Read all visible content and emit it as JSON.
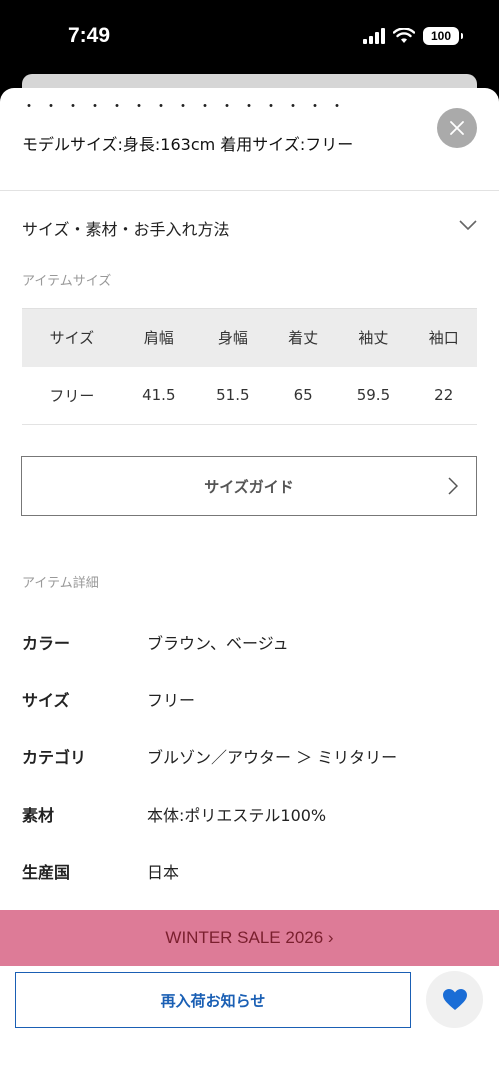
{
  "status_bar": {
    "time": "7:49",
    "battery": "100"
  },
  "model": {
    "dots": "・・・・・・・・・・・・・・・",
    "info": "モデルサイズ:身長:163cm 着用サイズ:フリー"
  },
  "accordion": {
    "title": "サイズ・素材・お手入れ方法"
  },
  "item_size": {
    "label": "アイテムサイズ",
    "headers": [
      "サイズ",
      "肩幅",
      "身幅",
      "着丈",
      "袖丈",
      "袖口"
    ],
    "rows": [
      [
        "フリー",
        "41.5",
        "51.5",
        "65",
        "59.5",
        "22"
      ]
    ]
  },
  "size_guide": {
    "label": "サイズガイド"
  },
  "item_detail": {
    "label": "アイテム詳細",
    "rows": [
      {
        "key": "カラー",
        "value": "ブラウン、ベージュ"
      },
      {
        "key": "サイズ",
        "value": "フリー"
      },
      {
        "key": "カテゴリ",
        "value": "ブルゾン／アウター ＞ ミリタリー"
      },
      {
        "key": "素材",
        "value": "本体:ポリエステル100%"
      },
      {
        "key": "生産国",
        "value": "日本"
      }
    ]
  },
  "sale_banner": {
    "text": "WINTER SALE 2026 ›"
  },
  "notify": {
    "label": "再入荷お知らせ"
  },
  "colors": {
    "sale_bg": "#dd7b97",
    "accent_blue": "#1a5fb4"
  },
  "icons": [
    "signal-icon",
    "wifi-icon",
    "battery-icon",
    "close-icon",
    "chevron-down-icon",
    "chevron-right-icon",
    "heart-icon"
  ]
}
